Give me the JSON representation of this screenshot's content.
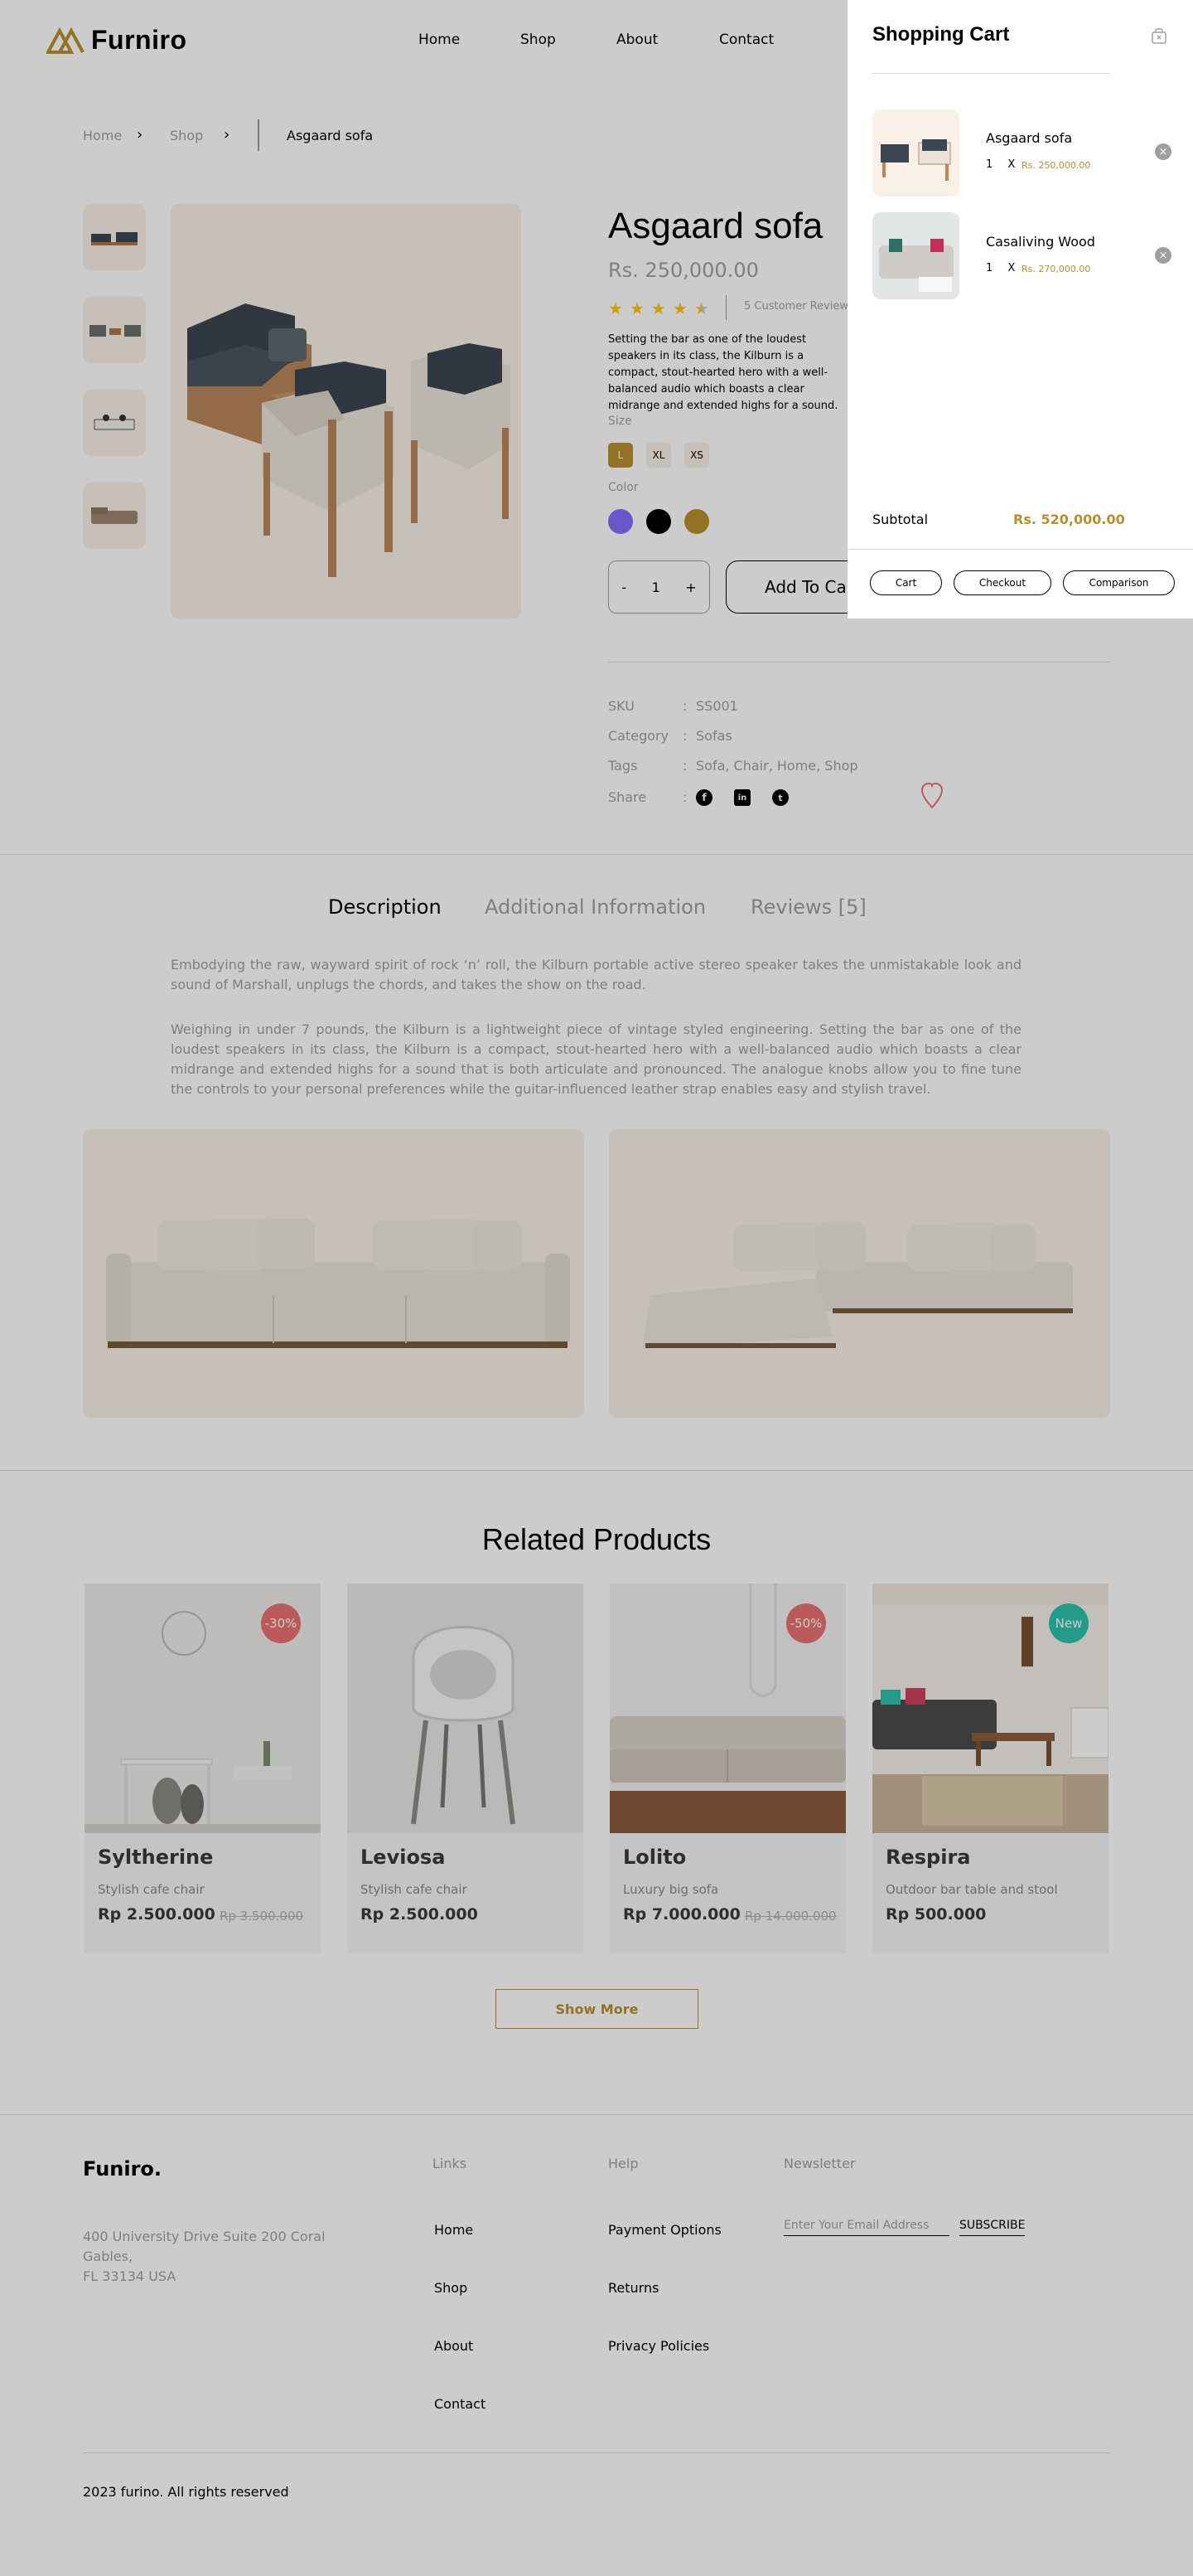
{
  "header": {
    "brand": "Furniro",
    "nav": [
      "Home",
      "Shop",
      "About",
      "Contact"
    ]
  },
  "breadcrumb": {
    "home": "Home",
    "shop": "Shop",
    "current": "Asgaard sofa"
  },
  "product": {
    "title": "Asgaard sofa",
    "price": "Rs. 250,000.00",
    "rating": 4.5,
    "reviews": "5 Customer Review",
    "description": "Setting the bar as one of the loudest speakers in its class, the Kilburn is a compact, stout-hearted hero with a well-balanced audio which boasts a clear midrange and extended highs for a sound.",
    "size_label": "Size",
    "sizes": [
      "L",
      "XL",
      "XS"
    ],
    "selected_size": "L",
    "color_label": "Color",
    "colors": [
      "#816DFA",
      "#000000",
      "#B88E2F"
    ],
    "quantity": "1",
    "qty_minus": "-",
    "qty_plus": "+",
    "add_to_cart": "Add To Cart",
    "meta": {
      "sku_label": "SKU",
      "sku": "SS001",
      "category_label": "Category",
      "category": "Sofas",
      "tags_label": "Tags",
      "tags": "Sofa, Chair, Home, Shop",
      "share_label": "Share",
      "colon": ":"
    },
    "share_icons": [
      "facebook-icon",
      "linkedin-icon",
      "twitter-icon"
    ]
  },
  "tabs": [
    "Description",
    "Additional Information",
    "Reviews [5]"
  ],
  "description": {
    "p1": "Embodying the raw, wayward spirit of rock ‘n’ roll, the Kilburn portable active stereo speaker takes the unmistakable look and sound of Marshall, unplugs the chords, and takes the show on the road.",
    "p2": "Weighing in under 7 pounds, the Kilburn is a lightweight piece of vintage styled engineering. Setting the bar as one of the loudest speakers in its class, the Kilburn is a compact, stout-hearted hero with a well-balanced audio which boasts a clear midrange and extended highs for a sound that is both articulate and pronounced. The analogue knobs allow you to fine tune the controls to your personal preferences while the guitar-influenced leather strap enables easy and stylish travel."
  },
  "related": {
    "title": "Related Products",
    "products": [
      {
        "name": "Syltherine",
        "sub": "Stylish cafe chair",
        "price": "Rp 2.500.000",
        "old": "Rp 3.500.000",
        "badge": "-30%",
        "badge_color": "#E97171"
      },
      {
        "name": "Leviosa",
        "sub": "Stylish cafe chair",
        "price": "Rp 2.500.000",
        "old": "",
        "badge": "",
        "badge_color": ""
      },
      {
        "name": "Lolito",
        "sub": "Luxury big sofa",
        "price": "Rp 7.000.000",
        "old": "Rp 14.000.000",
        "badge": "-50%",
        "badge_color": "#E97171"
      },
      {
        "name": "Respira",
        "sub": "Outdoor bar table and stool",
        "price": "Rp 500.000",
        "old": "",
        "badge": "New",
        "badge_color": "#2EC1AC"
      }
    ],
    "show_more": "Show More"
  },
  "footer": {
    "brand": "Funiro.",
    "address": [
      "400 University Drive Suite 200 Coral",
      "Gables,",
      "FL 33134 USA"
    ],
    "links_head": "Links",
    "links": [
      "Home",
      "Shop",
      "About",
      "Contact"
    ],
    "help_head": "Help",
    "help": [
      "Payment Options",
      "Returns",
      "Privacy Policies"
    ],
    "newsletter_head": "Newsletter",
    "newsletter_placeholder": "Enter Your Email Address",
    "subscribe": "SUBSCRIBE",
    "copyright": "2023 furino. All rights reserved"
  },
  "cart": {
    "title": "Shopping Cart",
    "items": [
      {
        "name": "Asgaard sofa",
        "qty": "1",
        "x": "X",
        "price": "Rs. 250,000.00"
      },
      {
        "name": "Casaliving Wood",
        "qty": "1",
        "x": "X",
        "price": "Rs. 270,000.00"
      }
    ],
    "subtotal_label": "Subtotal",
    "subtotal": "Rs. 520,000.00",
    "buttons": [
      "Cart",
      "Checkout",
      "Comparison"
    ]
  },
  "colors": {
    "accent": "#B88E2F",
    "muted": "#9F9F9F",
    "beige": "#F9F1E7",
    "overlay": "rgba(0,0,0,0.2)"
  }
}
